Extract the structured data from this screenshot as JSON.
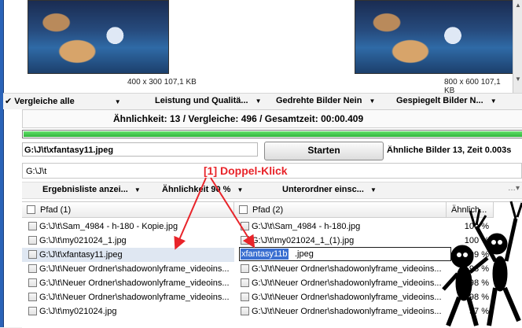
{
  "images": {
    "left_caption": "400 x 300 107,1 KB",
    "right_caption": "800 x 600 107,1 KB"
  },
  "options": {
    "compare_all": "Vergleiche alle",
    "performance": "Leistung und Qualitä...",
    "rotated": "Gedrehte Bilder Nein",
    "mirrored": "Gespiegelt Bilder N..."
  },
  "stats": {
    "text": "Ähnlichkeit: 13 / Vergleiche: 496 / Gesamtzeit: 00:00.409",
    "progress": 1.0
  },
  "search": {
    "file_path": "G:\\J\\t\\xfantasy11.jpeg",
    "start_label": "Starten",
    "similar_info": "Ähnliche Bilder 13, Zeit 0.003s",
    "folder": "G:\\J\\t"
  },
  "results_toolbar": {
    "results_list": "Ergebnisliste anzei...",
    "similarity": "Ähnlichkeit 90 %",
    "subfolders": "Unterordner einsc..."
  },
  "annotation": "[1] Doppel-Klick",
  "grid": {
    "col1_header": "Pfad (1)",
    "col2_header": "Pfad (2)",
    "col3_header": "Ähnlich...",
    "edit_selected": "xfantasy11b",
    "edit_rest": ".jpeg",
    "rows": [
      {
        "p1": "G:\\J\\t\\Sam_4984 - h-180 - Kopie.jpg",
        "p2": "G:\\J\\t\\Sam_4984 - h-180.jpg",
        "sim": "100 %"
      },
      {
        "p1": "G:\\J\\t\\my021024_1.jpg",
        "p2": "G:\\J\\t\\my021024_1_(1).jpg",
        "sim": "100 %"
      },
      {
        "p1": "G:\\J\\t\\xfantasy11.jpeg",
        "p2": "",
        "sim": "99 %"
      },
      {
        "p1": "G:\\J\\t\\Neuer Ordner\\shadowonlyframe_videoins...",
        "p2": "G:\\J\\t\\Neuer Ordner\\shadowonlyframe_videoins...",
        "sim": "98 %"
      },
      {
        "p1": "G:\\J\\t\\Neuer Ordner\\shadowonlyframe_videoins...",
        "p2": "G:\\J\\t\\Neuer Ordner\\shadowonlyframe_videoins...",
        "sim": "98 %"
      },
      {
        "p1": "G:\\J\\t\\Neuer Ordner\\shadowonlyframe_videoins...",
        "p2": "G:\\J\\t\\Neuer Ordner\\shadowonlyframe_videoins...",
        "sim": "98 %"
      },
      {
        "p1": "G:\\J\\t\\my021024.jpg",
        "p2": "G:\\J\\t\\Neuer Ordner\\shadowonlyframe_videoins...",
        "sim": "97 %"
      }
    ]
  },
  "colors": {
    "accent_blue": "#2a63b8",
    "progress_green": "#2fb53a",
    "annotation_red": "#e8242a"
  }
}
